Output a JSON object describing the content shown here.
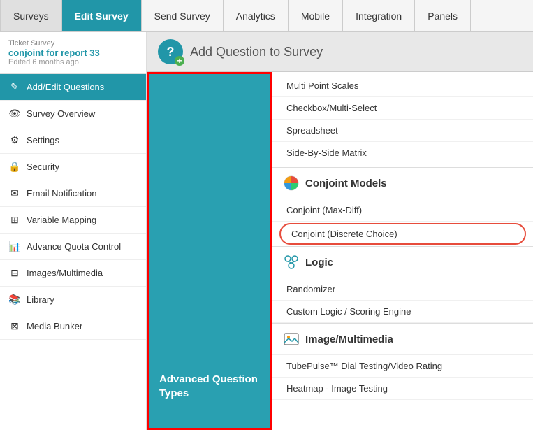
{
  "topNav": {
    "items": [
      {
        "id": "surveys",
        "label": "Surveys",
        "active": false
      },
      {
        "id": "edit-survey",
        "label": "Edit Survey",
        "active": true
      },
      {
        "id": "send-survey",
        "label": "Send Survey",
        "active": false
      },
      {
        "id": "analytics",
        "label": "Analytics",
        "active": false
      },
      {
        "id": "mobile",
        "label": "Mobile",
        "active": false
      },
      {
        "id": "integration",
        "label": "Integration",
        "active": false
      },
      {
        "id": "panels",
        "label": "Panels",
        "active": false
      }
    ]
  },
  "sidebar": {
    "surveyLabel": "Ticket Survey",
    "surveyName": "conjoint for report 33",
    "surveyEdited": "Edited 6 months ago",
    "items": [
      {
        "id": "add-edit-questions",
        "label": "Add/Edit Questions",
        "icon": "✎",
        "active": true
      },
      {
        "id": "survey-overview",
        "label": "Survey Overview",
        "icon": "👁",
        "active": false
      },
      {
        "id": "settings",
        "label": "Settings",
        "icon": "⚙",
        "active": false
      },
      {
        "id": "security",
        "label": "Security",
        "icon": "🔒",
        "active": false
      },
      {
        "id": "email-notification",
        "label": "Email Notification",
        "icon": "✉",
        "active": false
      },
      {
        "id": "variable-mapping",
        "label": "Variable Mapping",
        "icon": "⊞",
        "active": false
      },
      {
        "id": "advance-quota-control",
        "label": "Advance Quota Control",
        "icon": "📊",
        "active": false
      },
      {
        "id": "images-multimedia",
        "label": "Images/Multimedia",
        "icon": "⊟",
        "active": false
      },
      {
        "id": "library",
        "label": "Library",
        "icon": "📚",
        "active": false
      },
      {
        "id": "media-bunker",
        "label": "Media Bunker",
        "icon": "⊠",
        "active": false
      }
    ]
  },
  "addQuestionHeader": {
    "title": "Add Question to Survey"
  },
  "leftPanel": {
    "label": "Advanced Question Types"
  },
  "rightPanel": {
    "topItems": [
      {
        "id": "multi-point-scales",
        "label": "Multi Point Scales"
      },
      {
        "id": "checkbox-multi-select",
        "label": "Checkbox/Multi-Select"
      },
      {
        "id": "spreadsheet",
        "label": "Spreadsheet"
      },
      {
        "id": "side-by-side-matrix",
        "label": "Side-By-Side Matrix"
      }
    ],
    "sections": [
      {
        "id": "conjoint-models",
        "label": "Conjoint Models",
        "iconType": "pie",
        "items": [
          {
            "id": "conjoint-max-diff",
            "label": "Conjoint (Max-Diff)",
            "highlighted": false
          },
          {
            "id": "conjoint-discrete-choice",
            "label": "Conjoint (Discrete Choice)",
            "highlighted": true
          }
        ]
      },
      {
        "id": "logic",
        "label": "Logic",
        "iconType": "logic",
        "items": [
          {
            "id": "randomizer",
            "label": "Randomizer",
            "highlighted": false
          },
          {
            "id": "custom-logic",
            "label": "Custom Logic / Scoring Engine",
            "highlighted": false
          }
        ]
      },
      {
        "id": "image-multimedia",
        "label": "Image/Multimedia",
        "iconType": "image",
        "items": [
          {
            "id": "tubepulse",
            "label": "TubePulse™ Dial Testing/Video Rating",
            "highlighted": false
          },
          {
            "id": "heatmap",
            "label": "Heatmap - Image Testing",
            "highlighted": false
          }
        ]
      }
    ]
  }
}
